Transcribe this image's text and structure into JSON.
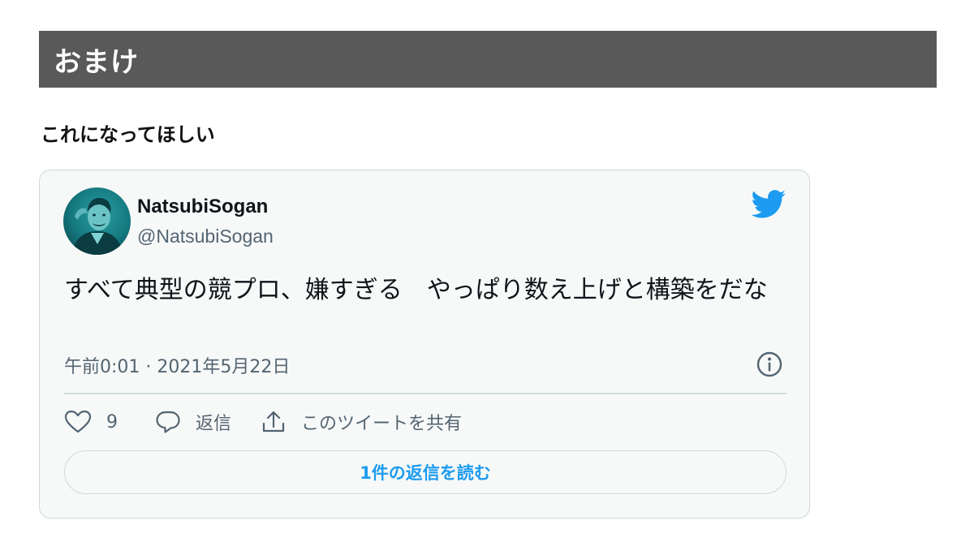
{
  "section": {
    "title": "おまけ"
  },
  "lead": {
    "text": "これになってほしい"
  },
  "tweet": {
    "display_name": "NatsubiSogan",
    "handle": "@NatsubiSogan",
    "text": "すべて典型の競プロ、嫌すぎる　やっぱり数え上げと構築をだな",
    "timestamp": "午前0:01 · 2021年5月22日",
    "actions": {
      "like_count": "9",
      "reply_label": "返信",
      "share_label": "このツイートを共有"
    },
    "read_replies_label": "1件の返信を読む",
    "icons": {
      "brand": "twitter-bird-icon",
      "info": "info-icon",
      "like": "heart-icon",
      "reply": "speech-bubble-icon",
      "share": "share-upload-icon"
    }
  },
  "colors": {
    "header_bg": "#595959",
    "twitter_blue": "#1d9bf0",
    "card_bg": "#f7f9f9",
    "card_border": "#cfd9de",
    "secondary_text": "#536471"
  }
}
